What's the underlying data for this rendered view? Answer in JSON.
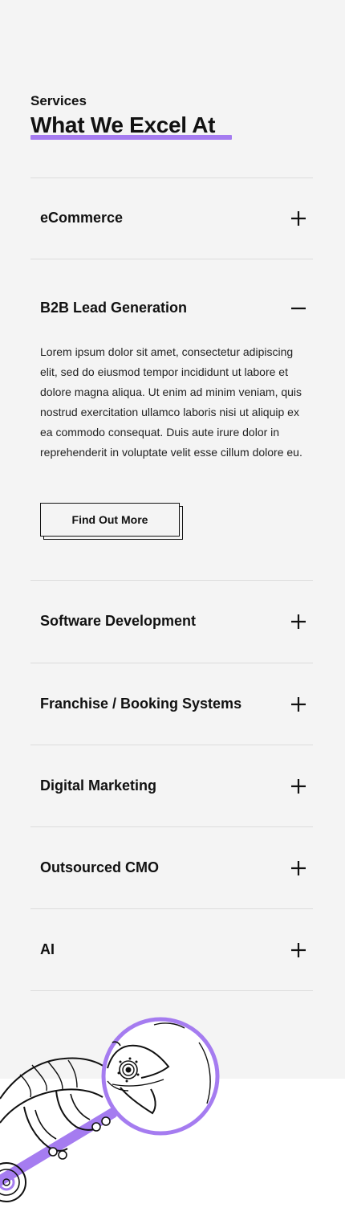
{
  "header": {
    "eyebrow": "Services",
    "title": "What We Excel At"
  },
  "accordion": {
    "items": [
      {
        "label": "eCommerce",
        "expanded": false,
        "toggle_icon": "plus-icon"
      },
      {
        "label": "B2B Lead Generation",
        "expanded": true,
        "toggle_icon": "minus-icon",
        "body": "Lorem ipsum dolor sit amet, consectetur adipiscing elit, sed do eiusmod tempor incididunt ut labore et dolore magna aliqua. Ut enim ad minim veniam, quis nostrud exercitation ullamco laboris nisi ut aliquip ex ea commodo consequat. Duis aute irure dolor in reprehenderit in voluptate velit esse cillum dolore eu.",
        "button_label": "Find Out More"
      },
      {
        "label": "Software Development",
        "expanded": false,
        "toggle_icon": "plus-icon"
      },
      {
        "label": "Franchise / Booking Systems",
        "expanded": false,
        "toggle_icon": "plus-icon"
      },
      {
        "label": "Digital Marketing",
        "expanded": false,
        "toggle_icon": "plus-icon"
      },
      {
        "label": "Outsourced CMO",
        "expanded": false,
        "toggle_icon": "plus-icon"
      },
      {
        "label": "AI",
        "expanded": false,
        "toggle_icon": "plus-icon"
      }
    ]
  },
  "illustration": {
    "name": "chameleon-magnifier-illustration"
  },
  "colors": {
    "accent": "#a57cf0",
    "section_bg": "#f4f4f4",
    "text": "#111111",
    "divider": "#dcdcdc"
  }
}
